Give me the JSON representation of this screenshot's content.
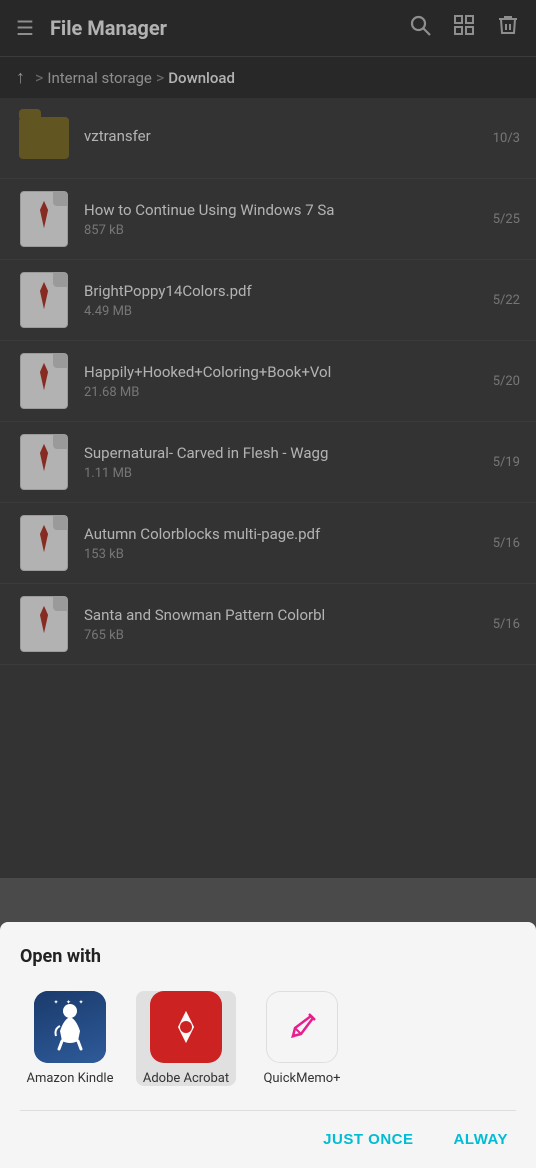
{
  "header": {
    "menu_icon": "≡",
    "title": "File Manager",
    "search_icon": "🔍",
    "view_icon": "▣",
    "delete_icon": "🗑"
  },
  "breadcrumb": {
    "up_icon": "↑",
    "separator": ">",
    "parent": "Internal storage",
    "current": "Download"
  },
  "files": [
    {
      "type": "folder",
      "name": "vztransfer",
      "size": "",
      "date": "10/3"
    },
    {
      "type": "pdf",
      "name": "How to Continue Using Windows 7 Sa",
      "size": "857 kB",
      "date": "5/25"
    },
    {
      "type": "pdf",
      "name": "BrightPoppy14Colors.pdf",
      "size": "4.49 MB",
      "date": "5/22"
    },
    {
      "type": "pdf",
      "name": "Happily+Hooked+Coloring+Book+Vol",
      "size": "21.68 MB",
      "date": "5/20"
    },
    {
      "type": "pdf",
      "name": "Supernatural- Carved in Flesh - Wagg",
      "size": "1.11 MB",
      "date": "5/19"
    },
    {
      "type": "pdf",
      "name": "Autumn Colorblocks multi-page.pdf",
      "size": "153 kB",
      "date": "5/16"
    },
    {
      "type": "pdf",
      "name": "Santa and Snowman Pattern Colorbl",
      "size": "765 kB",
      "date": "5/16"
    }
  ],
  "bottom_sheet": {
    "title": "Open with",
    "apps": [
      {
        "id": "kindle",
        "label": "Amazon Kindle",
        "selected": false
      },
      {
        "id": "acrobat",
        "label": "Adobe Acrobat",
        "selected": true
      },
      {
        "id": "quickmemo",
        "label": "QuickMemo+",
        "selected": false
      }
    ],
    "actions": [
      {
        "id": "just_once",
        "label": "JUST ONCE"
      },
      {
        "id": "always",
        "label": "ALWAY"
      }
    ]
  }
}
